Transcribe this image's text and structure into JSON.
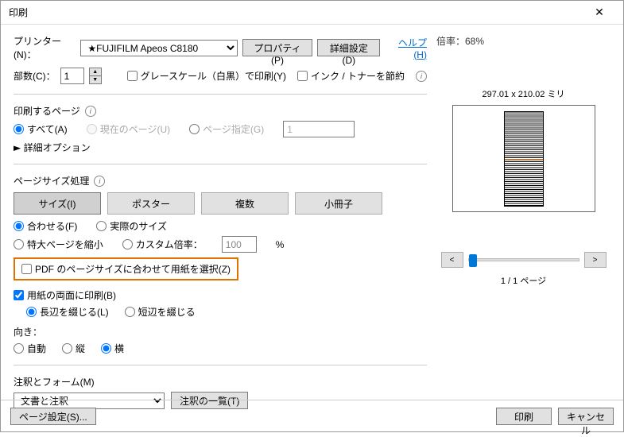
{
  "title": "印刷",
  "help": "ヘルプ(H)",
  "printer": {
    "label": "プリンター(N)：",
    "selected": "★FUJIFILM Apeos C8180",
    "properties": "プロパティ(P)",
    "advanced": "詳細設定(D)"
  },
  "copies": {
    "label": "部数(C)：",
    "value": "1"
  },
  "grayscale": "グレースケール（白黒）で印刷(Y)",
  "saveInk": "インク / トナーを節約",
  "pages": {
    "title": "印刷するページ",
    "all": "すべて(A)",
    "current": "現在のページ(U)",
    "range": "ページ指定(G)",
    "rangeValue": "1",
    "more": "詳細オプション"
  },
  "sizing": {
    "title": "ページサイズ処理",
    "tabs": {
      "size": "サイズ(I)",
      "poster": "ポスター",
      "multi": "複数",
      "booklet": "小冊子"
    },
    "fit": "合わせる(F)",
    "actual": "実際のサイズ",
    "shrink": "特大ページを縮小",
    "custom": "カスタム倍率：",
    "customValue": "100",
    "pdfPaper": "PDF のページサイズに合わせて用紙を選択(Z)"
  },
  "duplex": {
    "label": "用紙の両面に印刷(B)",
    "long": "長辺を綴じる(L)",
    "short": "短辺を綴じる"
  },
  "orient": {
    "title": "向き：",
    "auto": "自動",
    "portrait": "縦",
    "landscape": "横"
  },
  "comments": {
    "title": "注釈とフォーム(M)",
    "selected": "文書と注釈",
    "summary": "注釈の一覧(T)"
  },
  "preview": {
    "scale": "倍率：68%",
    "dim": "297.01 x 210.02 ミリ",
    "pageOf": "1 / 1 ページ",
    "prev": "<",
    "next": ">"
  },
  "footer": {
    "pageSetup": "ページ設定(S)...",
    "print": "印刷",
    "cancel": "キャンセル"
  }
}
